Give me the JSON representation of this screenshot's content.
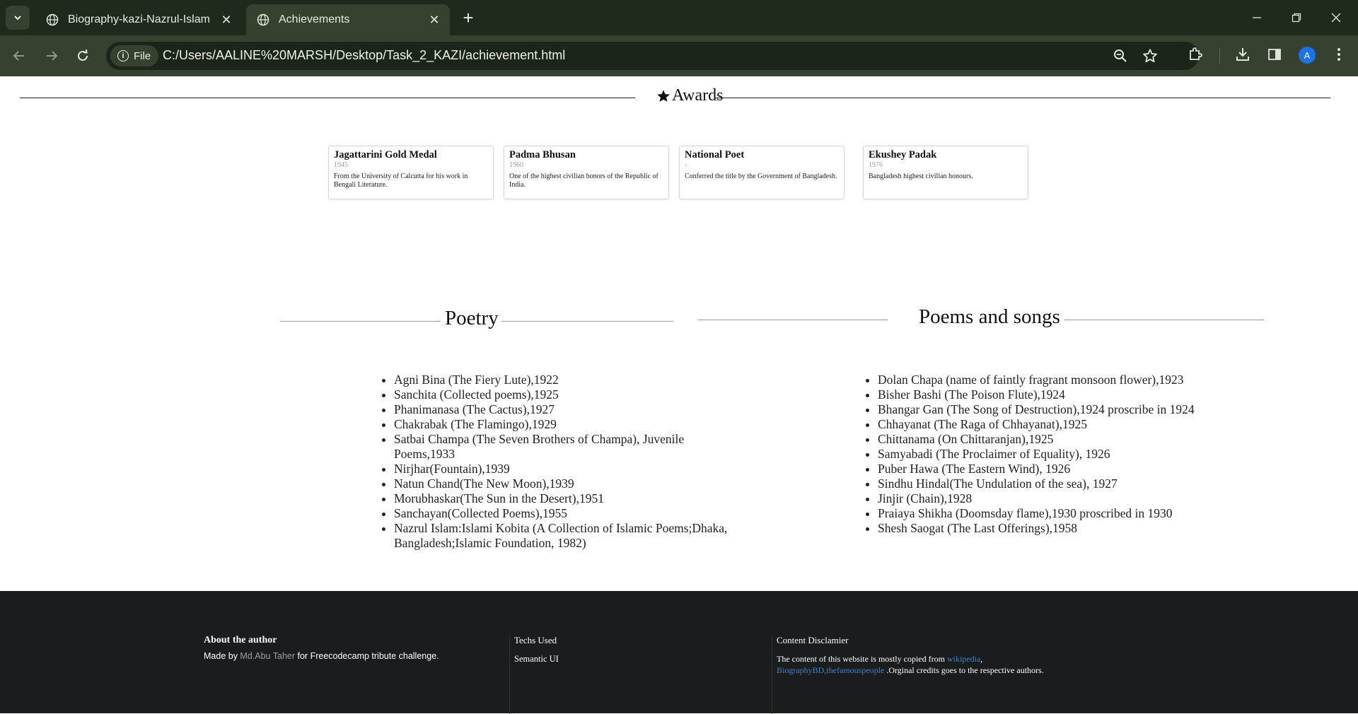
{
  "browser": {
    "tabs": [
      {
        "title": "Biography-kazi-Nazrul-Islam",
        "active": false
      },
      {
        "title": "Achievements",
        "active": true
      }
    ],
    "chip_label": "File",
    "url": "C:/Users/AALINE%20MARSH/Desktop/Task_2_KAZI/achievement.html",
    "profile_initial": "A"
  },
  "awards": {
    "heading": "Awards",
    "items": [
      {
        "title": "Jagattarini Gold Medal",
        "year": "1945",
        "desc": "From the University of Calcutta for his work in Bengali Literature."
      },
      {
        "title": "Padma Bhusan",
        "year": "1960",
        "desc": "One of the highest civilian honors of the Republic of India."
      },
      {
        "title": "National Poet",
        "year": "-",
        "desc": "Conferred the title by the Government of Bangladesh."
      },
      {
        "title": "Ekushey Padak",
        "year": "1976",
        "desc": "Bangladesh highest civilian honours."
      }
    ]
  },
  "poetry": {
    "heading": "Poetry",
    "items": [
      "Agni Bina (The Fiery Lute),1922",
      "Sanchita (Collected poems),1925",
      "Phanimanasa (The Cactus),1927",
      "Chakrabak (The Flamingo),1929",
      "Satbai Champa (The Seven Brothers of Champa), Juvenile Poems,1933",
      "Nirjhar(Fountain),1939",
      "Natun Chand(The New Moon),1939",
      "Morubhaskar(The Sun in the Desert),1951",
      "Sanchayan(Collected Poems),1955",
      "Nazrul Islam:Islami Kobita (A Collection of Islamic Poems;Dhaka, Bangladesh;Islamic Foundation, 1982)"
    ]
  },
  "poems_songs": {
    "heading": "Poems and songs",
    "items": [
      "Dolan Chapa (name of faintly fragrant monsoon flower),1923",
      "Bisher Bashi (The Poison Flute),1924",
      "Bhangar Gan (The Song of Destruction),1924 proscribe in 1924",
      "Chhayanat (The Raga of Chhayanat),1925",
      "Chittanama (On Chittaranjan),1925",
      "Samyabadi (The Proclaimer of Equality), 1926",
      "Puber Hawa (The Eastern Wind), 1926",
      "Sindhu Hindal(The Undulation of the sea), 1927",
      "Jinjir (Chain),1928",
      "Praiaya Shikha (Doomsday flame),1930 proscribed in 1930",
      "Shesh Saogat (The Last Offerings),1958"
    ]
  },
  "footer": {
    "about_heading": "About the author",
    "about_prefix": "Made by ",
    "author_link": "Md.Abu Taher",
    "about_suffix": " for Freecodecamp tribute challenge.",
    "techs_heading": "Techs Used",
    "techs_value": "Semantic UI",
    "disclaimer_heading": "Content Disclamier",
    "disclaimer_prefix": "The content of this website is mostly copied from ",
    "disclaimer_link1": "wikipedia",
    "disclaimer_sep": ",",
    "disclaimer_link2": "BiographyBD,thefamouspeople",
    "disclaimer_suffix": " .Orginal credits goes to the respective authors."
  }
}
